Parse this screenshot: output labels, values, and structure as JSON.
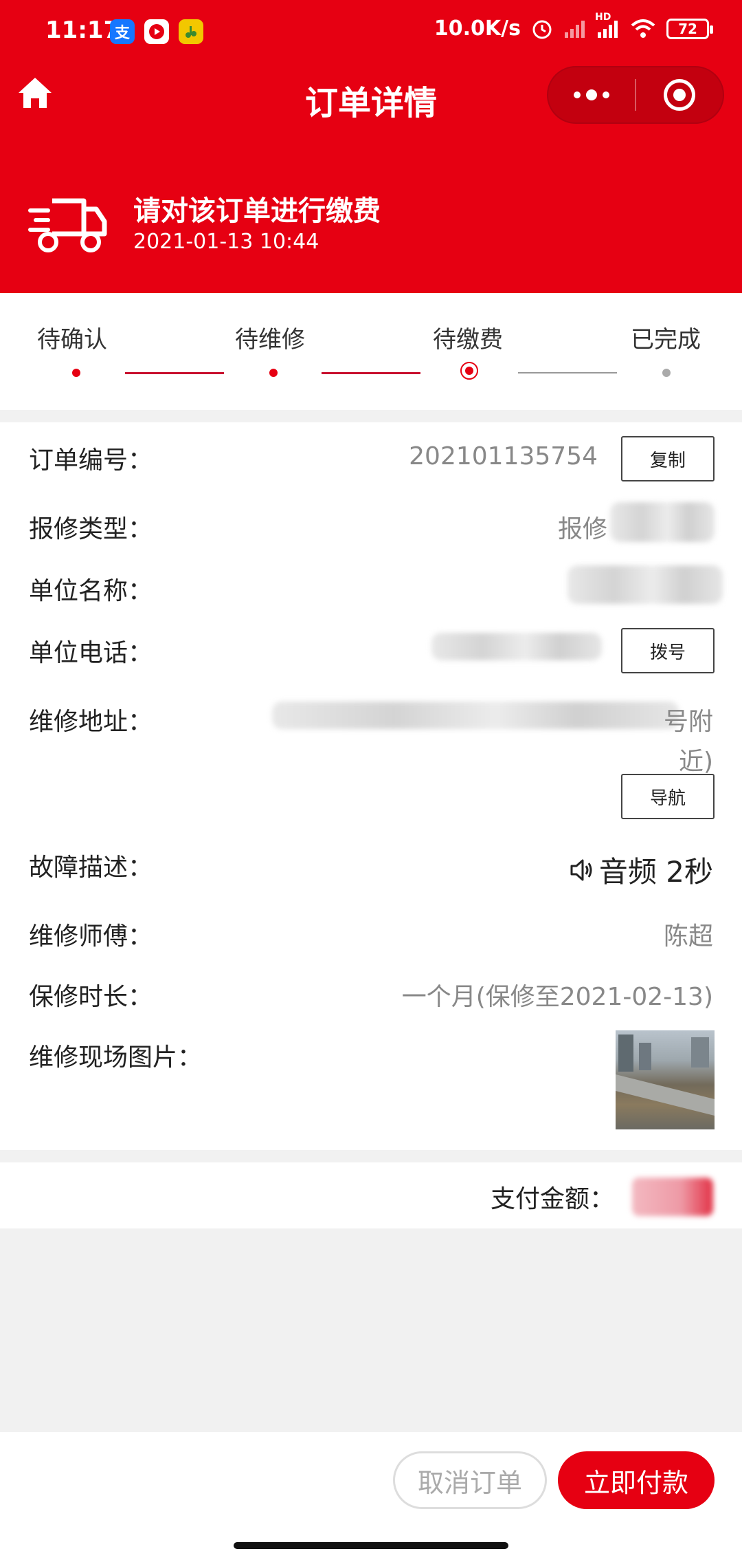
{
  "status_bar": {
    "time": "11:17",
    "network_speed": "10.0K/s",
    "battery": "72",
    "signal_tag": "HD"
  },
  "nav": {
    "title": "订单详情"
  },
  "banner": {
    "title": "请对该订单进行缴费",
    "time": "2021-01-13 10:44"
  },
  "steps": [
    {
      "label": "待确认"
    },
    {
      "label": "待维修"
    },
    {
      "label": "待缴费"
    },
    {
      "label": "已完成"
    }
  ],
  "steps_current_index": 2,
  "details": {
    "order_no_label": "订单编号：",
    "order_no": "202101135754",
    "copy_button": "复制",
    "repair_type_label": "报修类型：",
    "repair_type": "报修",
    "unit_name_label": "单位名称：",
    "unit_phone_label": "单位电话：",
    "dial_button": "拨号",
    "address_label": "维修地址：",
    "address_tail_1": "号附",
    "address_tail_2": "近)",
    "navigate_button": "导航",
    "fault_label": "故障描述：",
    "fault_audio": "音频 2秒",
    "technician_label": "维修师傅：",
    "technician": "陈超",
    "warranty_label": "保修时长：",
    "warranty": "一个月(保修至2021-02-13)",
    "photos_label": "维修现场图片："
  },
  "payment": {
    "label": "支付金额："
  },
  "actions": {
    "cancel": "取消订单",
    "pay": "立即付款"
  },
  "colors": {
    "brand_red": "#e60012"
  }
}
